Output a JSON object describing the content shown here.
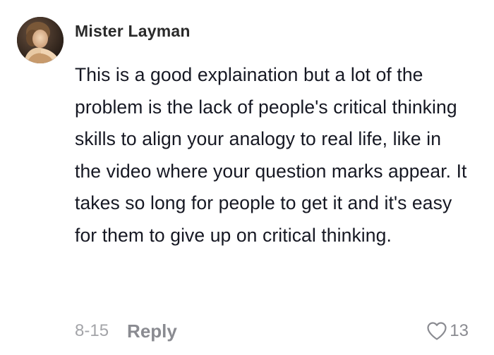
{
  "comment": {
    "username": "Mister Layman",
    "text": "This is a good explaination but a lot of the problem is the lack of people's critical thinking skills to align your analogy to real life, like in the video where your question marks appear. It takes so long for people to get it and it's easy for them to give up on critical thinking.",
    "date": "8-15",
    "reply_label": "Reply",
    "like_count": "13",
    "avatar_icon": "user-avatar-portrait",
    "like_icon": "heart-outline-icon"
  }
}
